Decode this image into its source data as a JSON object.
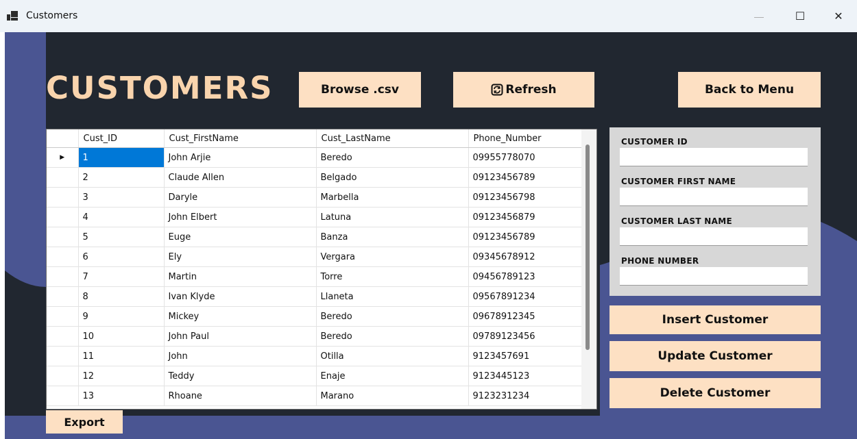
{
  "window": {
    "title": "Customers",
    "minimize_glyph": "—",
    "maximize_glyph": "☐",
    "close_glyph": "✕"
  },
  "header": {
    "title": "CUSTOMERS",
    "browse_label": "Browse .csv",
    "refresh_label": "Refresh",
    "back_label": "Back to Menu"
  },
  "grid": {
    "current_row_marker": "▶",
    "columns": [
      "Cust_ID",
      "Cust_FirstName",
      "Cust_LastName",
      "Phone_Number"
    ],
    "rows": [
      [
        "1",
        "John Arjie",
        "Beredo",
        "09955778070"
      ],
      [
        "2",
        "Claude Allen",
        "Belgado",
        "09123456789"
      ],
      [
        "3",
        "Daryle",
        "Marbella",
        "09123456798"
      ],
      [
        "4",
        "John Elbert",
        "Latuna",
        "09123456879"
      ],
      [
        "5",
        "Euge",
        "Banza",
        "09123456789"
      ],
      [
        "6",
        "Ely",
        "Vergara",
        "09345678912"
      ],
      [
        "7",
        "Martin",
        "Torre",
        "09456789123"
      ],
      [
        "8",
        "Ivan Klyde",
        "Llaneta",
        "09567891234"
      ],
      [
        "9",
        "Mickey",
        "Beredo",
        "09678912345"
      ],
      [
        "10",
        "John Paul",
        "Beredo",
        "09789123456"
      ],
      [
        "11",
        "John",
        "Otilla",
        "9123457691"
      ],
      [
        "12",
        "Teddy",
        "Enaje",
        "9123445123"
      ],
      [
        "13",
        "Rhoane",
        "Marano",
        "9123231234"
      ]
    ]
  },
  "form": {
    "id_label": "CUSTOMER ID",
    "first_name_label": "CUSTOMER FIRST NAME",
    "last_name_label": "CUSTOMER LAST NAME",
    "phone_label": "PHONE NUMBER",
    "id_value": "",
    "first_name_value": "",
    "last_name_value": "",
    "phone_value": ""
  },
  "actions": {
    "insert_label": "Insert Customer",
    "update_label": "Update Customer",
    "delete_label": "Delete Customer",
    "export_label": "Export"
  },
  "colors": {
    "background_dark": "#212730",
    "background_blue": "#4a5592",
    "accent_peach": "#fde0c3",
    "title_peach": "#f9d4ad",
    "selection": "#0078d7"
  }
}
